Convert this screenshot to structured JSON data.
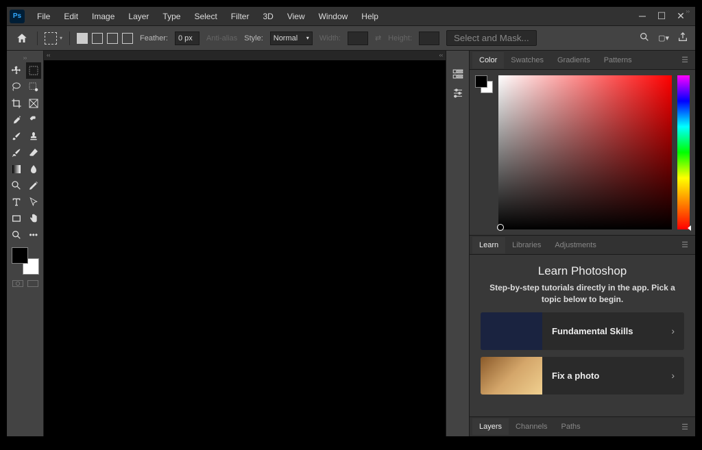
{
  "menubar": [
    "File",
    "Edit",
    "Image",
    "Layer",
    "Type",
    "Select",
    "Filter",
    "3D",
    "View",
    "Window",
    "Help"
  ],
  "logo": "Ps",
  "optbar": {
    "feather_label": "Feather:",
    "feather_value": "0 px",
    "antialias": "Anti-alias",
    "style_label": "Style:",
    "style_value": "Normal",
    "width_label": "Width:",
    "height_label": "Height:",
    "select_mask": "Select and Mask..."
  },
  "color_tabs": [
    "Color",
    "Swatches",
    "Gradients",
    "Patterns"
  ],
  "learn_tabs": [
    "Learn",
    "Libraries",
    "Adjustments"
  ],
  "learn": {
    "title": "Learn Photoshop",
    "subtitle": "Step-by-step tutorials directly in the app. Pick a topic below to begin.",
    "cards": [
      "Fundamental Skills",
      "Fix a photo"
    ]
  },
  "layers_tabs": [
    "Layers",
    "Channels",
    "Paths"
  ]
}
